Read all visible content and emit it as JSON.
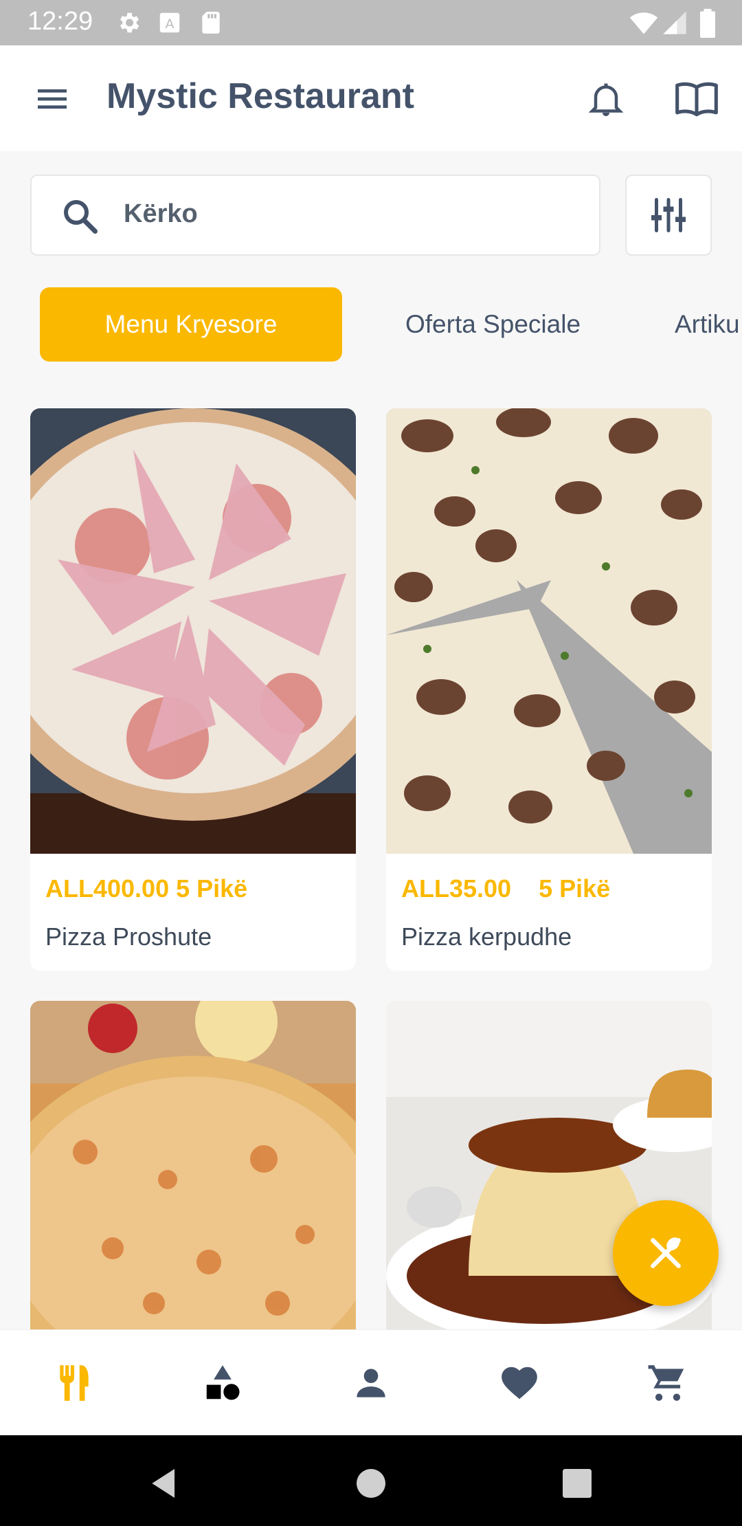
{
  "status_bar": {
    "time": "12:29"
  },
  "app_bar": {
    "title": "Mystic Restaurant"
  },
  "search": {
    "placeholder": "Kërko"
  },
  "tabs": [
    {
      "label": "Menu Kryesore",
      "active": true
    },
    {
      "label": "Oferta Speciale",
      "active": false
    },
    {
      "label": "Artiku",
      "active": false
    }
  ],
  "items": [
    {
      "price": "ALL400.00 5 Pikë",
      "name": "Pizza Proshute"
    },
    {
      "price": "ALL35.00    5 Pikë",
      "name": "Pizza kerpudhe"
    },
    {
      "price": "",
      "name": ""
    },
    {
      "price": "",
      "name": ""
    }
  ],
  "colors": {
    "accent": "#fbb800",
    "text": "#44536a",
    "background": "#f7f7f7"
  },
  "bottom_nav": [
    "restaurant-menu-icon",
    "categories-icon",
    "profile-icon",
    "favorites-icon",
    "cart-icon"
  ]
}
